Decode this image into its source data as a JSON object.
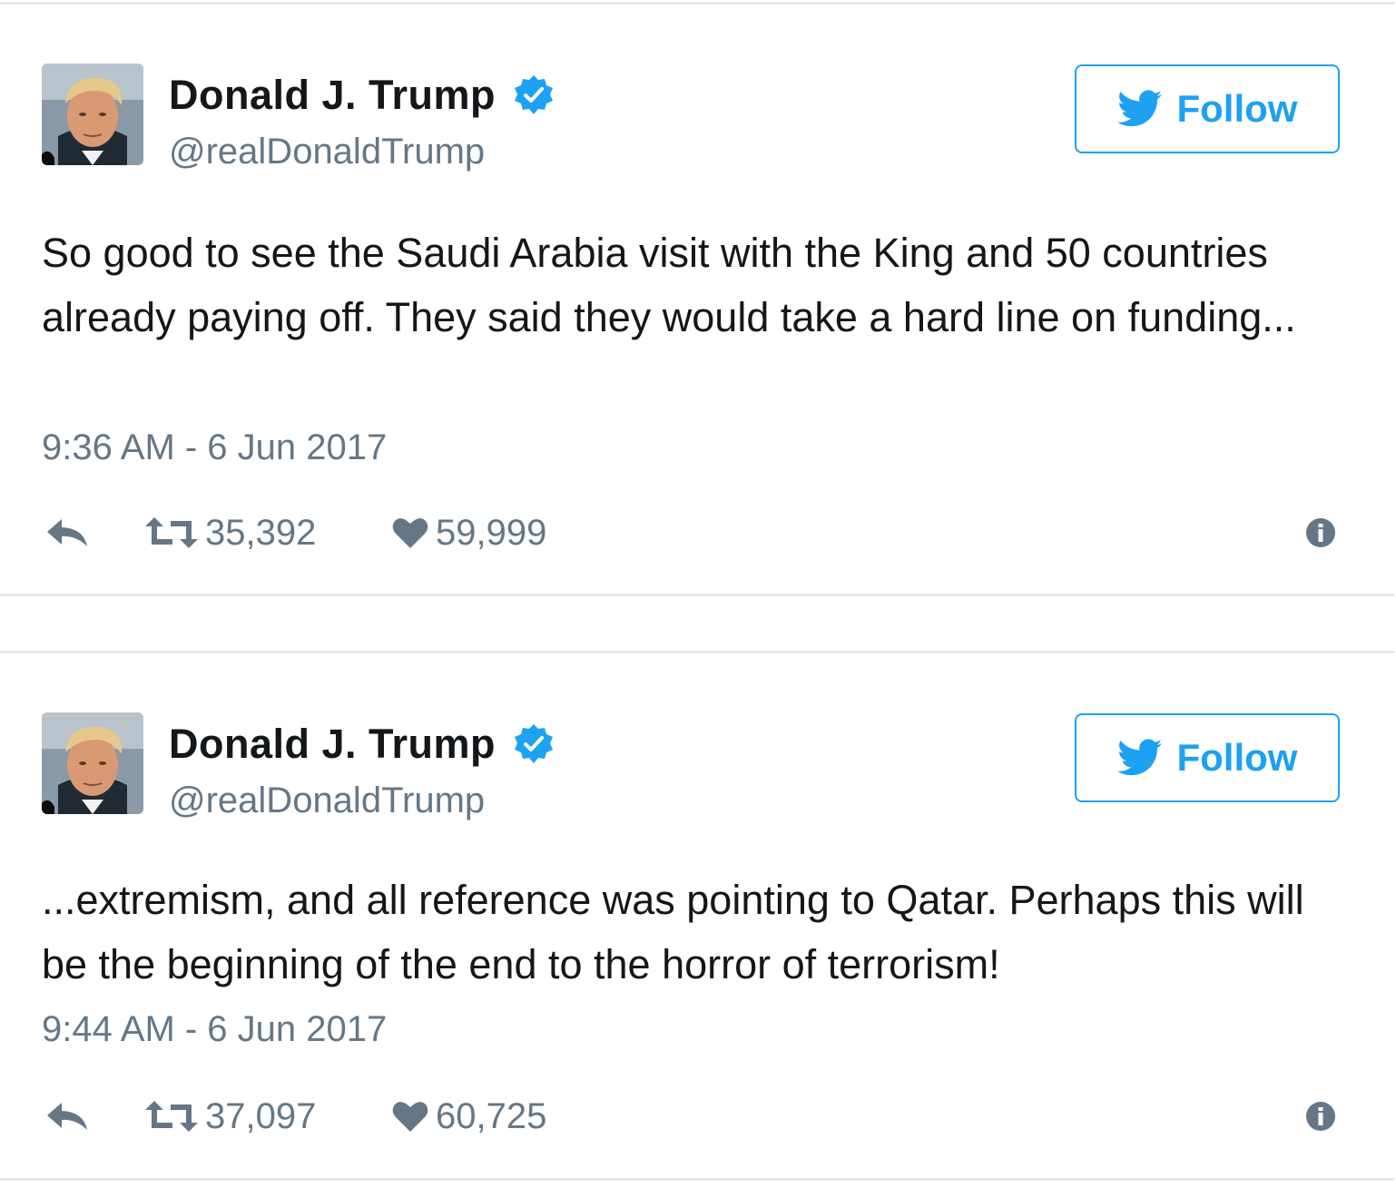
{
  "tweets": [
    {
      "author": {
        "name": "Donald J. Trump",
        "handle": "@realDonaldTrump",
        "verified": true
      },
      "follow_label": "Follow",
      "text": "So good to see the Saudi Arabia visit with the King and 50 countries already paying off. They said they would take a hard line on funding...",
      "timestamp": "9:36 AM - 6 Jun 2017",
      "retweets": "35,392",
      "likes": "59,999"
    },
    {
      "author": {
        "name": "Donald J. Trump",
        "handle": "@realDonaldTrump",
        "verified": true
      },
      "follow_label": "Follow",
      "text": "...extremism, and all reference was pointing to Qatar. Perhaps this will be the beginning of the end to the horror of terrorism!",
      "timestamp": "9:44 AM - 6 Jun 2017",
      "retweets": "37,097",
      "likes": "60,725"
    }
  ],
  "icons": {
    "verified": "verified-badge-icon",
    "follow": "twitter-bird-icon",
    "reply": "reply-icon",
    "retweet": "retweet-icon",
    "like": "heart-icon",
    "info": "info-icon"
  },
  "colors": {
    "accent": "#1da1f2",
    "verified": "#1da1f2",
    "muted": "#657786",
    "text": "#14171a",
    "border": "#e1e8ed"
  }
}
